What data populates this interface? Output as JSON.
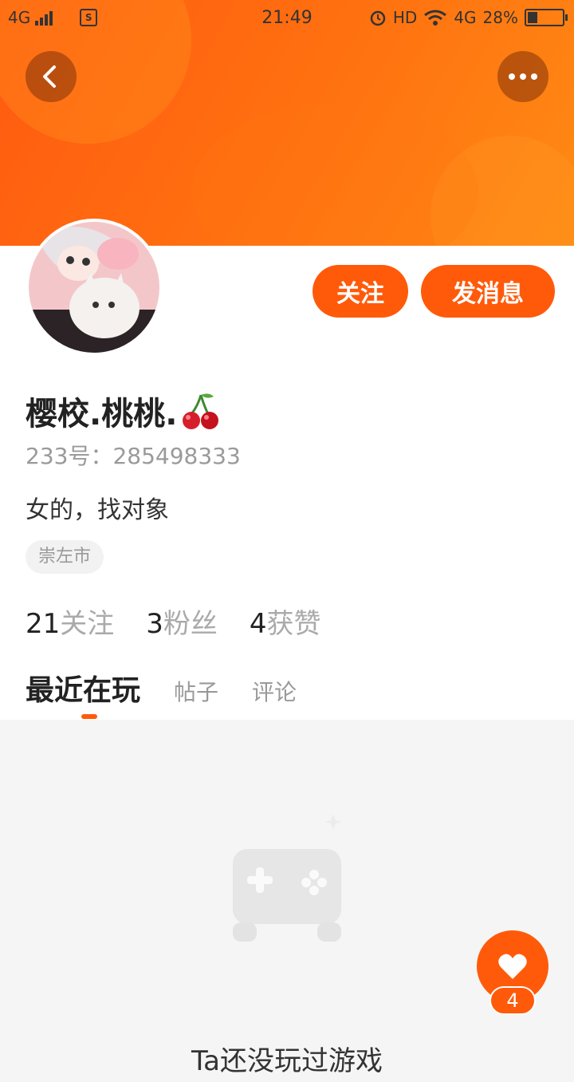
{
  "status_bar": {
    "network_left": "4G",
    "time": "21:49",
    "hd": "HD",
    "network_right": "4G",
    "battery_text": "28%",
    "battery_level": 0.28
  },
  "header": {
    "back_icon": "chevron-left-icon",
    "more_icon": "more-horizontal-icon"
  },
  "actions": {
    "follow_label": "关注",
    "message_label": "发消息"
  },
  "profile": {
    "name": "樱校.桃桃.",
    "id_text": "233号：285498333",
    "bio": "女的，找对象",
    "location_tag": "崇左市",
    "stats": [
      {
        "count": "21",
        "label": "关注"
      },
      {
        "count": "3",
        "label": "粉丝"
      },
      {
        "count": "4",
        "label": "获赞"
      }
    ]
  },
  "tabs": [
    "最近在玩",
    "帖子",
    "评论"
  ],
  "empty_state": {
    "icon": "gamepad-icon",
    "text": "Ta还没玩过游戏"
  },
  "like_fab": {
    "icon": "heart-icon",
    "count": "4"
  },
  "colors": {
    "accent": "#ff5a0a",
    "header_gradient_start": "#ff5a10",
    "header_gradient_end": "#ff8a14"
  }
}
